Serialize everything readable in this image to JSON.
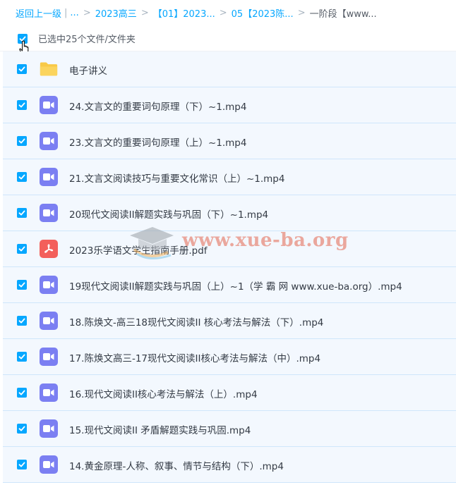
{
  "breadcrumb": {
    "back_label": "返回上一级",
    "ellipsis": "...",
    "items": [
      "2023高三",
      "【01】2023...",
      "05【2023陈...",
      "一阶段【www..."
    ],
    "separator": ">"
  },
  "selection": {
    "summary": "已选中25个文件/文件夹",
    "checked": true
  },
  "files": [
    {
      "name": "电子讲义",
      "type": "folder",
      "checked": true
    },
    {
      "name": "24.文言文的重要词句原理（下）~1.mp4",
      "type": "video",
      "checked": true
    },
    {
      "name": "23.文言文的重要词句原理（上）~1.mp4",
      "type": "video",
      "checked": true
    },
    {
      "name": "21.文言文阅读技巧与重要文化常识（上）~1.mp4",
      "type": "video",
      "checked": true
    },
    {
      "name": "20现代文阅读II解题实践与巩固（下）~1.mp4",
      "type": "video",
      "checked": true
    },
    {
      "name": "2023乐学语文学生指南手册.pdf",
      "type": "pdf",
      "checked": true
    },
    {
      "name": "19现代文阅读II解题实践与巩固（上）~1（学 霸 网 www.xue-ba.org）.mp4",
      "type": "video",
      "checked": true
    },
    {
      "name": "18.陈焕文-高三18现代文阅读II 核心考法与解法（下）.mp4",
      "type": "video",
      "checked": true
    },
    {
      "name": "17.陈焕文高三-17现代文阅读II核心考法与解法（中）.mp4",
      "type": "video",
      "checked": true
    },
    {
      "name": "16.现代文阅读II核心考法与解法（上）.mp4",
      "type": "video",
      "checked": true
    },
    {
      "name": "15.现代文阅读II 矛盾解题实践与巩固.mp4",
      "type": "video",
      "checked": true
    },
    {
      "name": "14.黄金原理-人称、叙事、情节与结构（下）.mp4",
      "type": "video",
      "checked": true
    }
  ],
  "watermark": {
    "text": "www.xue-ba.org"
  },
  "colors": {
    "accent": "#06a7ff",
    "row_bg": "#f3f8fe",
    "video_icon": "#7b7ff2",
    "pdf_icon": "#f35f5b",
    "folder_icon": "#f8c947"
  }
}
